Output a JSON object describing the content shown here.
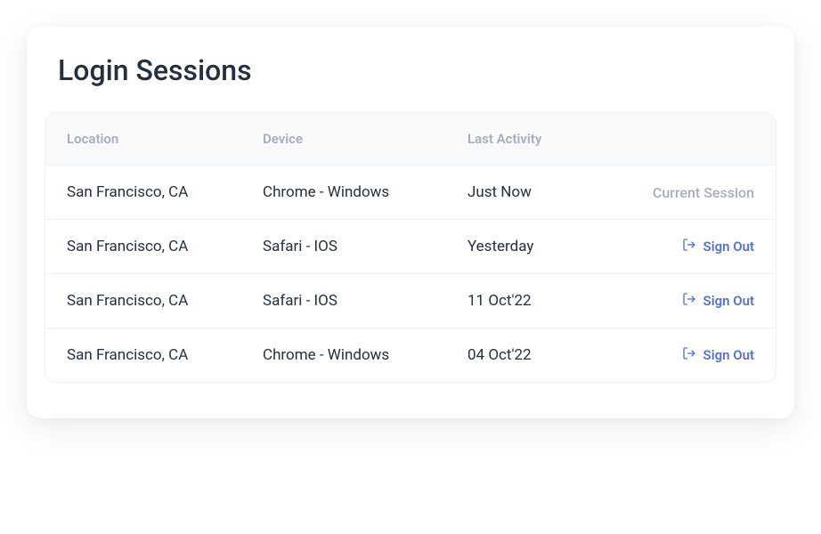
{
  "title": "Login Sessions",
  "headers": {
    "location": "Location",
    "device": "Device",
    "last_activity": "Last Activity"
  },
  "current_session_label": "Current Session",
  "sign_out_label": "Sign Out",
  "sessions": [
    {
      "location": "San Francisco, CA",
      "device": "Chrome - Windows",
      "last_activity": "Just Now",
      "is_current": true
    },
    {
      "location": "San Francisco, CA",
      "device": "Safari - IOS",
      "last_activity": "Yesterday",
      "is_current": false
    },
    {
      "location": "San Francisco, CA",
      "device": "Safari - IOS",
      "last_activity": "11 Oct'22",
      "is_current": false
    },
    {
      "location": "San Francisco, CA",
      "device": "Chrome - Windows",
      "last_activity": "04 Oct'22",
      "is_current": false
    }
  ]
}
